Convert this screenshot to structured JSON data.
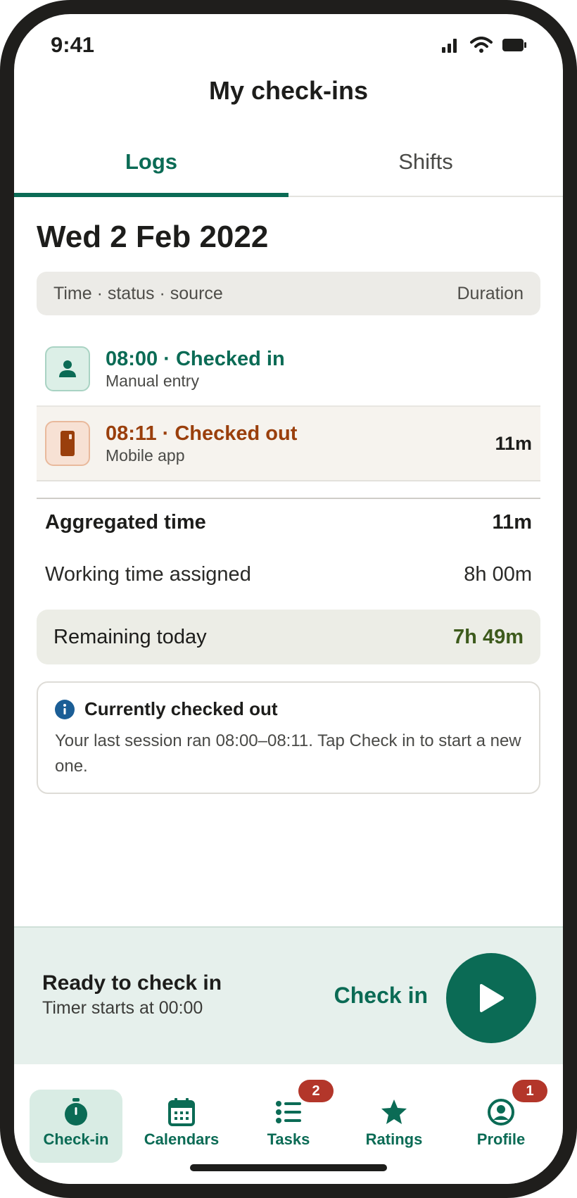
{
  "status_bar": {
    "time": "9:41"
  },
  "header": {
    "title": "My check-ins"
  },
  "tabs": [
    {
      "label": "Logs",
      "active": true
    },
    {
      "label": "Shifts",
      "active": false
    }
  ],
  "date": "Wed 2 Feb 2022",
  "table_header": {
    "left": "Time · status · source",
    "right": "Duration"
  },
  "logs": [
    {
      "title": "08:00 · Checked in",
      "source": "Manual entry",
      "duration": "",
      "icon": "person-icon",
      "color": "#0b6b55"
    },
    {
      "title": "08:11 · Checked out",
      "source": "Mobile app",
      "duration": "11m",
      "icon": "phone-icon",
      "color": "#9a3f0c"
    }
  ],
  "summary": {
    "aggregated_label": "Aggregated time",
    "aggregated_value": "11m",
    "assigned_label": "Working time assigned",
    "assigned_value": "8h 00m",
    "remaining_label": "Remaining today",
    "remaining_value": "7h 49m"
  },
  "info": {
    "icon": "info-icon",
    "title": "Currently checked out",
    "body": "Your last session ran 08:00–08:11. Tap Check in to start a new one."
  },
  "checkin": {
    "title": "Ready to check in",
    "subtitle": "Timer starts at 00:00",
    "button_label": "Check in",
    "button_icon": "play-icon"
  },
  "nav": [
    {
      "label": "Check-in",
      "icon": "stopwatch-icon",
      "active": true,
      "badge": ""
    },
    {
      "label": "Calendars",
      "icon": "calendar-icon",
      "active": false,
      "badge": ""
    },
    {
      "label": "Tasks",
      "icon": "list-icon",
      "active": false,
      "badge": "2"
    },
    {
      "label": "Ratings",
      "icon": "star-icon",
      "active": false,
      "badge": ""
    },
    {
      "label": "Profile",
      "icon": "profile-icon",
      "active": false,
      "badge": "1"
    }
  ],
  "colors": {
    "brand": "#0b6b55",
    "checkout": "#9a3f0c",
    "badge": "#b3362a",
    "remaining": "#3d5a1c"
  }
}
